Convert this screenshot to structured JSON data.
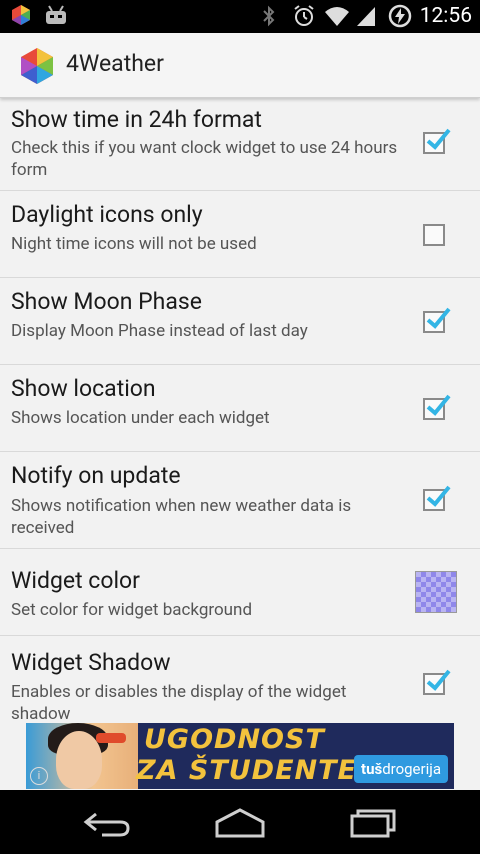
{
  "status_bar": {
    "clock": "12:56",
    "icons": [
      "app-notification-icon",
      "android-debug-icon",
      "bluetooth-icon",
      "alarm-icon",
      "wifi-icon",
      "signal-icon",
      "battery-charging-icon"
    ]
  },
  "action_bar": {
    "icon": "4weather-logo-icon",
    "title": "4Weather"
  },
  "preferences": [
    {
      "title": "Show time in 24h format",
      "summary": "Check this if you want clock widget to use 24 hours form",
      "control": "checkbox",
      "checked": true
    },
    {
      "title": "Daylight icons only",
      "summary": "Night time icons will not be used",
      "control": "checkbox",
      "checked": false
    },
    {
      "title": "Show Moon Phase",
      "summary": "Display Moon Phase instead of last day",
      "control": "checkbox",
      "checked": true
    },
    {
      "title": "Show location",
      "summary": "Shows location under each widget",
      "control": "checkbox",
      "checked": true
    },
    {
      "title": "Notify on update",
      "summary": "Shows notification when new weather data is received",
      "control": "checkbox",
      "checked": true
    },
    {
      "title": "Widget color",
      "summary": "Set color for widget background",
      "control": "color",
      "color": "#b9b4f2"
    },
    {
      "title": "Widget Shadow",
      "summary": "Enables or disables the display of the widget shadow",
      "control": "checkbox",
      "checked": true
    }
  ],
  "ad": {
    "line1": "UGODNOST",
    "line2": "ZA ŠTUDENTE",
    "brand_bold": "tuš",
    "brand_rest": "drogerija",
    "info": "i"
  },
  "nav_bar": {
    "icons": [
      "back-icon",
      "home-icon",
      "recent-apps-icon"
    ]
  },
  "colors": {
    "accent_check": "#33b5e5",
    "background": "#f2f2f2",
    "ad_text": "#f3c23d"
  }
}
